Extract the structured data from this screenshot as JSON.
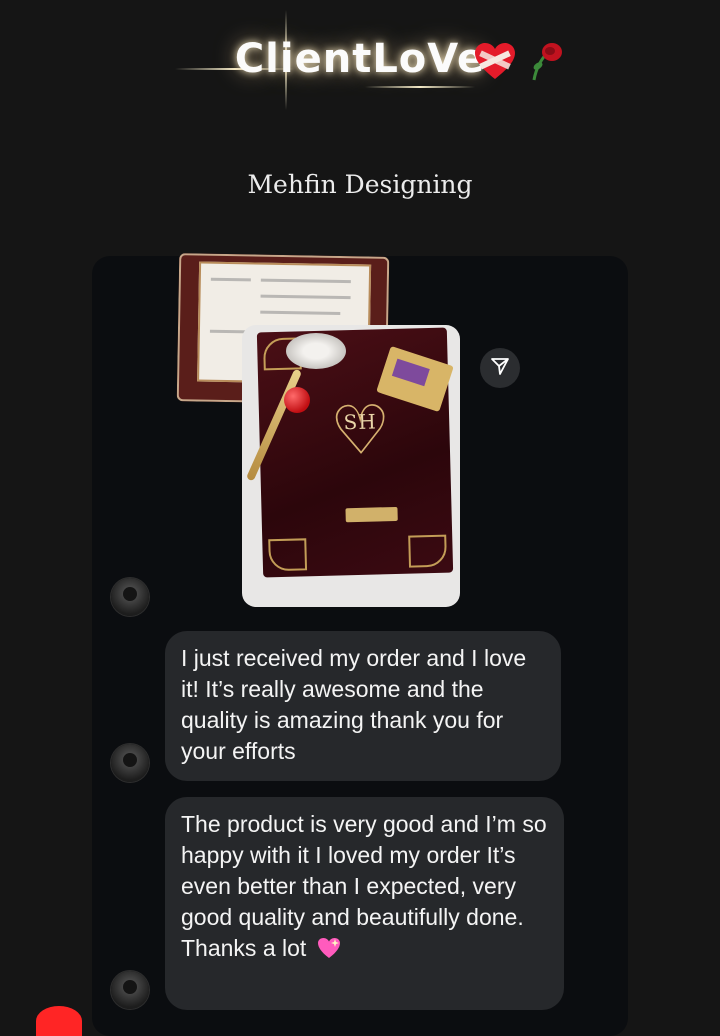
{
  "header": {
    "title": "ClientLoVe",
    "emoji_icons": [
      "mending-heart-icon",
      "wilted-rose-icon"
    ]
  },
  "subtitle": "Mehfin Designing",
  "photo": {
    "monogram": "SH",
    "description_icon": "invitation-folder-image"
  },
  "messages": [
    {
      "text": "I just received my order and I love it! It’s really awesome and the quality is amazing thank you for your efforts"
    },
    {
      "text": "The product is very good and I’m so happy with it I loved my order It’s even better than I expected, very good quality and beautifully done. Thanks a lot",
      "emoji": "sparkling-heart-icon"
    }
  ],
  "colors": {
    "background": "#151515",
    "panel": "#0b0d10",
    "bubble": "#26282b",
    "accent_red": "#ff2525"
  }
}
